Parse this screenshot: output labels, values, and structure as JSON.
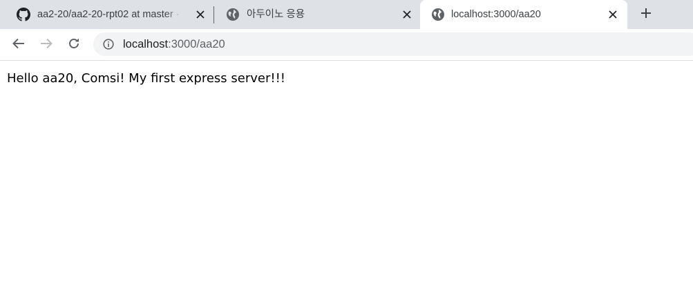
{
  "tabs": [
    {
      "title": "aa2-20/aa2-20-rpt02 at master ·",
      "favicon": "github-icon",
      "active": false
    },
    {
      "title": "아두이노 응용",
      "favicon": "globe-icon",
      "active": false
    },
    {
      "title": "localhost:3000/aa20",
      "favicon": "globe-icon",
      "active": true
    }
  ],
  "address_bar": {
    "host": "localhost",
    "path": ":3000/aa20",
    "security_icon": "info-icon"
  },
  "page": {
    "body_text": "Hello aa20, Comsi! My first express server!!!"
  },
  "colors": {
    "tabstrip_bg": "#dee1e6",
    "active_tab_bg": "#ffffff",
    "omnibox_bg": "#f1f3f4",
    "icon_color": "#5f6368",
    "disabled_icon_color": "#babcbe"
  }
}
